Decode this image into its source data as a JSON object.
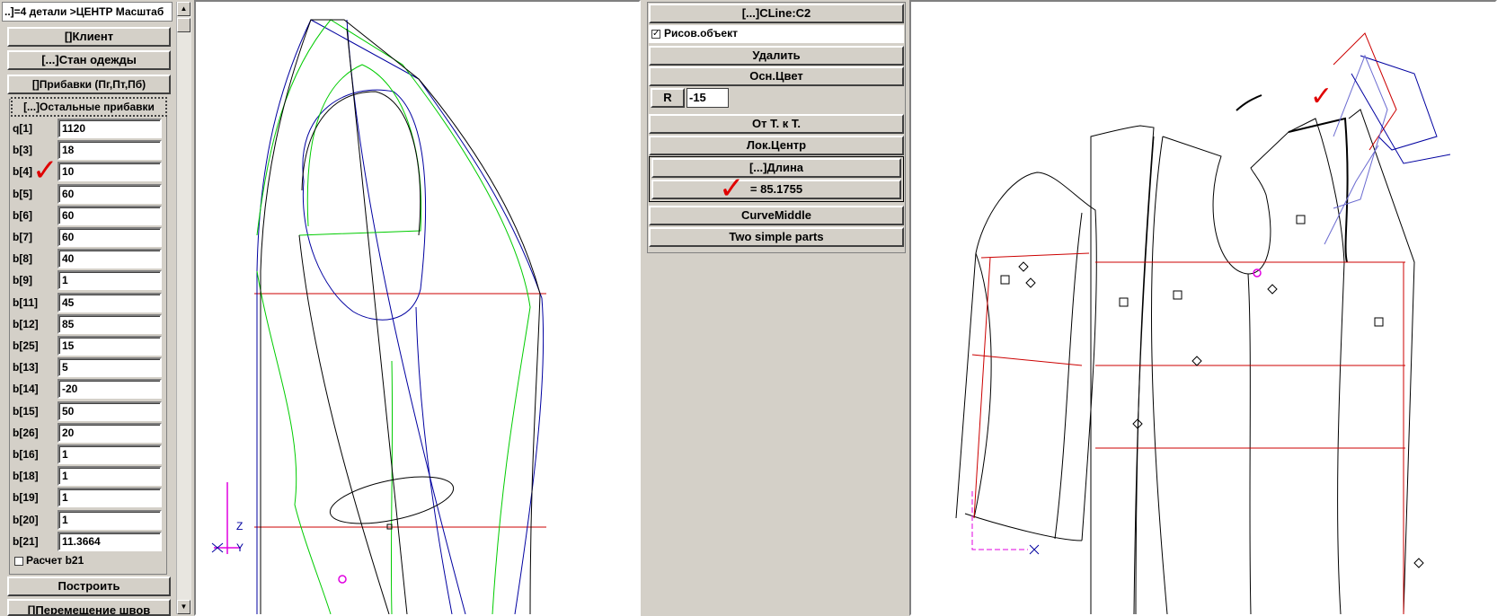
{
  "params": {
    "title": "..]=4 детали >ЦЕНТР Масштаб",
    "buttons": {
      "client": "[]Клиент",
      "stan": "[...]Стан одежды",
      "pribavki": "[]Прибавки (Пг,Пт,Пб)",
      "others": "[...]Остальные прибавки"
    },
    "rows": [
      {
        "label": "q[1]",
        "value": "1120"
      },
      {
        "label": "b[3]",
        "value": "18"
      },
      {
        "label": "b[4]",
        "value": "10"
      },
      {
        "label": "b[5]",
        "value": "60"
      },
      {
        "label": "b[6]",
        "value": "60"
      },
      {
        "label": "b[7]",
        "value": "60"
      },
      {
        "label": "b[8]",
        "value": "40"
      },
      {
        "label": "b[9]",
        "value": "1"
      },
      {
        "label": "b[11]",
        "value": "45"
      },
      {
        "label": "b[12]",
        "value": "85"
      },
      {
        "label": "b[25]",
        "value": "15"
      },
      {
        "label": "b[13]",
        "value": "5"
      },
      {
        "label": "b[14]",
        "value": "-20"
      },
      {
        "label": "b[15]",
        "value": "50"
      },
      {
        "label": "b[26]",
        "value": "20"
      },
      {
        "label": "b[16]",
        "value": "1"
      },
      {
        "label": "b[18]",
        "value": "1"
      },
      {
        "label": "b[19]",
        "value": "1"
      },
      {
        "label": "b[20]",
        "value": "1"
      },
      {
        "label": "b[21]",
        "value": "11.3664"
      }
    ],
    "calc_b21": "Расчет b21",
    "build": "Построить",
    "move_seams": "[]Перемещение швов"
  },
  "mid": {
    "title": "[...]CLine:C2",
    "draw_object": "Рисов.объект",
    "draw_object_checked": true,
    "delete": "Удалить",
    "main_color": "Осн.Цвет",
    "r_label": "R",
    "r_value": "-15",
    "from_point": "От Т. к Т.",
    "loc_center": "Лок.Центр",
    "length_header": "[...]Длина",
    "length_value": "= 85.1755",
    "curve_middle": "CurveMiddle",
    "two_parts": "Two simple parts"
  },
  "canvas1": {
    "axis_z": "Z",
    "axis_y": "Y",
    "axis_x": "X"
  },
  "colors": {
    "red": "#cc0000",
    "blue": "#0000a0",
    "green": "#00cc00",
    "magenta": "#e000e0",
    "black": "#000000"
  }
}
